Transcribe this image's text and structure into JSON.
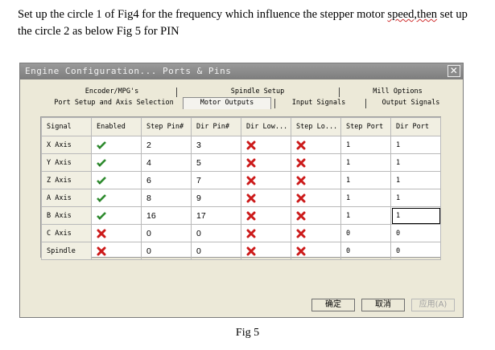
{
  "intro": {
    "line1_start": "Set up the circle 1 of Fig4 for the frequency which influence the stepper motor ",
    "line1_squiggle": "speed,then",
    "line1_end": " set up",
    "line2": "the circle 2 as below Fig 5 for PIN"
  },
  "window": {
    "title": "Engine Configuration... Ports & Pins",
    "close": "✕"
  },
  "tabs": {
    "row1": [
      "Encoder/MPG's",
      "Spindle Setup",
      "Mill Options"
    ],
    "row2": [
      "Port Setup and Axis Selection",
      "Motor Outputs",
      "Input Signals",
      "Output Signals"
    ]
  },
  "grid": {
    "columns": [
      "Signal",
      "Enabled",
      "Step Pin#",
      "Dir Pin#",
      "Dir Low...",
      "Step Lo...",
      "Step Port",
      "Dir Port"
    ],
    "rows": [
      {
        "signal": "X Axis",
        "enabled": true,
        "step_pin": "2",
        "dir_pin": "3",
        "dir_low": false,
        "step_low": false,
        "step_port": "1",
        "dir_port": "1"
      },
      {
        "signal": "Y Axis",
        "enabled": true,
        "step_pin": "4",
        "dir_pin": "5",
        "dir_low": false,
        "step_low": false,
        "step_port": "1",
        "dir_port": "1"
      },
      {
        "signal": "Z Axis",
        "enabled": true,
        "step_pin": "6",
        "dir_pin": "7",
        "dir_low": false,
        "step_low": false,
        "step_port": "1",
        "dir_port": "1"
      },
      {
        "signal": "A Axis",
        "enabled": true,
        "step_pin": "8",
        "dir_pin": "9",
        "dir_low": false,
        "step_low": false,
        "step_port": "1",
        "dir_port": "1"
      },
      {
        "signal": "B Axis",
        "enabled": true,
        "step_pin": "16",
        "dir_pin": "17",
        "dir_low": false,
        "step_low": false,
        "step_port": "1",
        "dir_port": "1"
      },
      {
        "signal": "C Axis",
        "enabled": false,
        "step_pin": "0",
        "dir_pin": "0",
        "dir_low": false,
        "step_low": false,
        "step_port": "0",
        "dir_port": "0"
      },
      {
        "signal": "Spindle",
        "enabled": false,
        "step_pin": "0",
        "dir_pin": "0",
        "dir_low": false,
        "step_low": false,
        "step_port": "0",
        "dir_port": "0"
      }
    ]
  },
  "buttons": {
    "ok": "确定",
    "cancel": "取消",
    "apply": "应用(A)"
  },
  "caption": "Fig 5",
  "colors": {
    "check": "#2e8b2e",
    "cross": "#cc1a1a",
    "titlebar": "#8a8a8a",
    "dialog_bg": "#ece9d8"
  },
  "icons": {
    "enabled_true": "green-check-icon",
    "enabled_false": "red-x-icon"
  }
}
